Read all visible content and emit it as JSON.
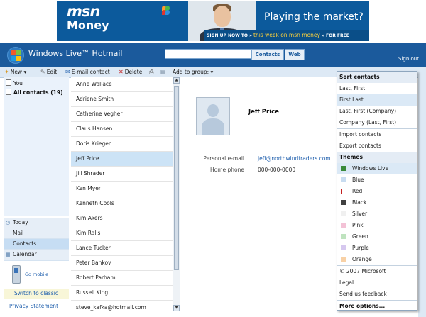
{
  "ad": {
    "brand_line1": "msn",
    "brand_line2": "Money",
    "headline": "Playing the market?",
    "tagline_prefix": "SIGN UP NOW TO »",
    "tagline_highlight": "this week on msn money",
    "tagline_suffix": "» FOR FREE"
  },
  "header": {
    "brand": "Windows Live™ Hotmail",
    "search_value": "",
    "contacts_btn": "Contacts",
    "web_btn": "Web",
    "signout": "Sign out"
  },
  "toolbar": {
    "new": "New ▾",
    "edit": "Edit",
    "email_contact": "E-mail contact",
    "delete": "Delete",
    "add_to_group": "Add to group: ▾"
  },
  "sidebar": {
    "you": "You",
    "all_contacts": "All contacts (19)",
    "nav": [
      {
        "label": "Today",
        "icon": "today-icon"
      },
      {
        "label": "Mail",
        "icon": "mail-icon"
      },
      {
        "label": "Contacts",
        "icon": "contacts-icon"
      },
      {
        "label": "Calendar",
        "icon": "calendar-icon"
      }
    ],
    "go_mobile": "Go mobile",
    "switch_classic": "Switch to classic",
    "privacy": "Privacy Statement"
  },
  "contacts": [
    "Anne Wallace",
    "Adriene Smith",
    "Catherine Vegher",
    "Claus Hansen",
    "Doris Krieger",
    "Jeff Price",
    "Jill Shrader",
    "Ken Myer",
    "Kenneth Cools",
    "Kim Akers",
    "Kim Ralls",
    "Lance Tucker",
    "Peter Bankov",
    "Robert Parham",
    "Russell King",
    "steve_kafka@hotmail.com"
  ],
  "selected_contact_index": 5,
  "details": {
    "name": "Jeff Price",
    "email_label": "Personal e-mail",
    "email_value": "jeff@northwindtraders.com",
    "phone_label": "Home phone",
    "phone_value": "000-000-0000"
  },
  "menu": {
    "sort_title": "Sort contacts",
    "sort": [
      "Last, First",
      "First Last",
      "Last, First (Company)",
      "Company (Last, First)"
    ],
    "import": "Import contacts",
    "export": "Export contacts",
    "themes_title": "Themes",
    "themes": [
      {
        "label": "Windows Live",
        "color": "#3a8a3a"
      },
      {
        "label": "Blue",
        "color": "#c8dcf0"
      },
      {
        "label": "Red",
        "color": "#c42020"
      },
      {
        "label": "Black",
        "color": "#404040"
      },
      {
        "label": "Silver",
        "color": "#e8e8e8"
      },
      {
        "label": "Pink",
        "color": "#f3c2d6"
      },
      {
        "label": "Green",
        "color": "#bfe3bf"
      },
      {
        "label": "Purple",
        "color": "#d6c8ef"
      },
      {
        "label": "Orange",
        "color": "#f8d1a6"
      }
    ],
    "copyright": "© 2007 Microsoft",
    "legal": "Legal",
    "feedback": "Send us feedback",
    "more": "More options..."
  },
  "colors": {
    "header_blue": "#1b5a9c",
    "toolbar_bg": "#dde9f5",
    "selection": "#cce3f6",
    "link": "#1f5fad"
  }
}
